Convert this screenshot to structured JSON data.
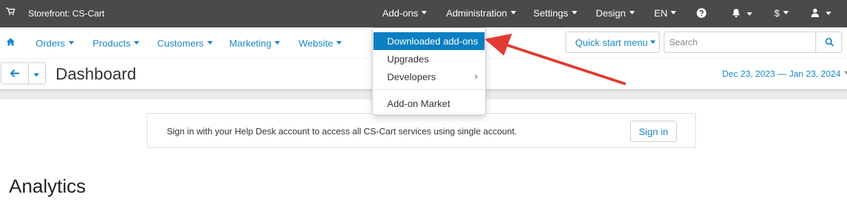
{
  "topbar": {
    "storefront": "Storefront: CS-Cart",
    "menu": {
      "addons": "Add-ons",
      "administration": "Administration",
      "settings": "Settings",
      "design": "Design",
      "language": "EN",
      "currency": "$"
    }
  },
  "nav": {
    "orders": "Orders",
    "products": "Products",
    "customers": "Customers",
    "marketing": "Marketing",
    "website": "Website",
    "quick_start": "Quick start menu",
    "search_placeholder": "Search"
  },
  "header": {
    "title": "Dashboard",
    "date_range": "Dec 23, 2023 — Jan 23, 2024"
  },
  "signin": {
    "message": "Sign in with your Help Desk account to access all CS-Cart services using single account.",
    "button": "Sign in"
  },
  "section": {
    "analytics": "Analytics"
  },
  "addons_dropdown": {
    "items": [
      "Downloaded add-ons",
      "Upgrades",
      "Developers",
      "Add-on Market"
    ],
    "active_item": "Downloaded add-ons"
  },
  "colors": {
    "topbar_bg": "#4a4a4a",
    "link": "#1a88c9",
    "active_menu": "#0a7fc2",
    "annotation_arrow": "#e03a32"
  },
  "icons": [
    "cart-icon",
    "question-icon",
    "bell-icon",
    "user-icon",
    "home-icon",
    "search-icon",
    "arrow-left-icon",
    "submenu-arrow-icon"
  ]
}
